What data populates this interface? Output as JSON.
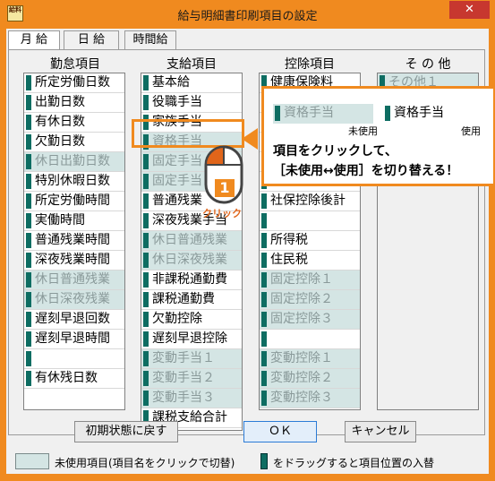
{
  "window": {
    "title": "給与明細書印刷項目の設定",
    "close_glyph": "✕",
    "icon_text": "給料"
  },
  "tabs": [
    {
      "label": "月 給",
      "active": true
    },
    {
      "label": "日 給",
      "active": false
    },
    {
      "label": "時間給",
      "active": false
    }
  ],
  "columns": {
    "attendance": {
      "header": "勤怠項目",
      "items": [
        {
          "label": "所定労働日数",
          "used": true
        },
        {
          "label": "出勤日数",
          "used": true
        },
        {
          "label": "有休日数",
          "used": true
        },
        {
          "label": "欠勤日数",
          "used": true
        },
        {
          "label": "休日出勤日数",
          "used": false
        },
        {
          "label": "特別休暇日数",
          "used": true
        },
        {
          "label": "所定労働時間",
          "used": true
        },
        {
          "label": "実働時間",
          "used": true
        },
        {
          "label": "普通残業時間",
          "used": true
        },
        {
          "label": "深夜残業時間",
          "used": true
        },
        {
          "label": "休日普通残業",
          "used": false
        },
        {
          "label": "休日深夜残業",
          "used": false
        },
        {
          "label": "遅刻早退回数",
          "used": true
        },
        {
          "label": "遅刻早退時間",
          "used": true
        },
        {
          "label": "",
          "used": true
        },
        {
          "label": "有休残日数",
          "used": true
        }
      ]
    },
    "payment": {
      "header": "支給項目",
      "items": [
        {
          "label": "基本給",
          "used": true
        },
        {
          "label": "役職手当",
          "used": true
        },
        {
          "label": "家族手当",
          "used": true
        },
        {
          "label": "資格手当",
          "used": false
        },
        {
          "label": "固定手当",
          "used": false
        },
        {
          "label": "固定手当",
          "used": false
        },
        {
          "label": "普通残業",
          "used": true
        },
        {
          "label": "深夜残業手当",
          "used": true
        },
        {
          "label": "休日普通残業",
          "used": false
        },
        {
          "label": "休日深夜残業",
          "used": false
        },
        {
          "label": "非課税通勤費",
          "used": true
        },
        {
          "label": "課税通勤費",
          "used": true
        },
        {
          "label": "欠勤控除",
          "used": true
        },
        {
          "label": "遅刻早退控除",
          "used": true
        },
        {
          "label": "変動手当１",
          "used": false
        },
        {
          "label": "変動手当２",
          "used": false
        },
        {
          "label": "変動手当３",
          "used": false
        },
        {
          "label": "課税支給合計",
          "used": true
        }
      ]
    },
    "deduction": {
      "header": "控除項目",
      "items": [
        {
          "label": "健康保険料",
          "used": true
        },
        {
          "label": "",
          "used": true
        },
        {
          "label": "",
          "used": true
        },
        {
          "label": "",
          "used": true
        },
        {
          "label": "",
          "used": true
        },
        {
          "label": "",
          "used": true
        },
        {
          "label": "社保控除後計",
          "used": true
        },
        {
          "label": "",
          "used": true
        },
        {
          "label": "所得税",
          "used": true
        },
        {
          "label": "住民税",
          "used": true
        },
        {
          "label": "固定控除１",
          "used": false
        },
        {
          "label": "固定控除２",
          "used": false
        },
        {
          "label": "固定控除３",
          "used": false
        },
        {
          "label": "",
          "used": true
        },
        {
          "label": "変動控除１",
          "used": false
        },
        {
          "label": "変動控除２",
          "used": false
        },
        {
          "label": "変動控除３",
          "used": false
        }
      ]
    },
    "other": {
      "header": "そ の 他",
      "items": [
        {
          "label": "その他１",
          "used": false
        }
      ]
    }
  },
  "callout": {
    "unused_demo": "資格手当",
    "used_demo": "資格手当",
    "unused_label": "未使用",
    "used_label": "使用",
    "line1": "項目をクリックして、",
    "line2": "［未使用↔使用］を切り替える！",
    "step_number": "1",
    "click_label": "クリック"
  },
  "buttons": {
    "reset": "初期状態に戻す",
    "ok": "ＯＫ",
    "cancel": "キャンセル"
  },
  "legend": {
    "unused_text": "未使用項目(項目名をクリックで切替)",
    "drag_text": "をドラッグすると項目位置の入替"
  },
  "colors": {
    "accent": "#f08a1f",
    "handle": "#0e6d62",
    "unused_bg": "#d4e5e4"
  }
}
